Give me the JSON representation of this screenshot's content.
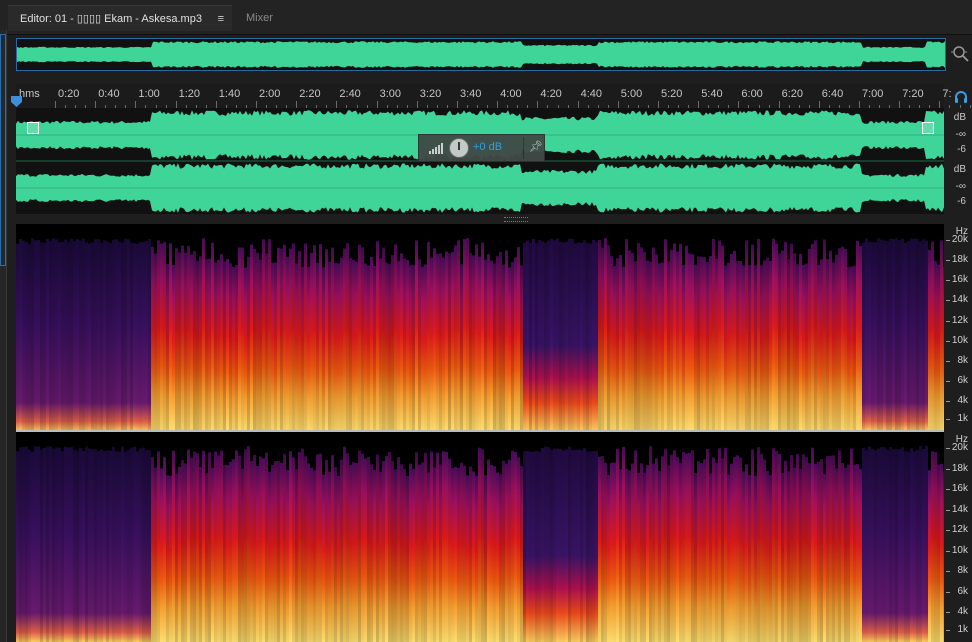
{
  "tabs": {
    "editor_label": "Editor: 01 - ▯▯▯▯ Ekam - Askesa.mp3",
    "editor_menu": "≡",
    "mixer_label": "Mixer"
  },
  "ruler": {
    "unit": "hms",
    "labels": [
      "0:20",
      "0:40",
      "1:00",
      "1:20",
      "1:40",
      "2:00",
      "2:20",
      "2:40",
      "3:00",
      "3:20",
      "3:40",
      "4:00",
      "4:20",
      "4:40",
      "5:00",
      "5:20",
      "5:40",
      "6:00",
      "6:20",
      "6:40",
      "7:00",
      "7:20",
      "7:"
    ]
  },
  "hud": {
    "volume": "+0 dB"
  },
  "amplitude_scale": {
    "left": [
      "dB",
      "-∞",
      "-6"
    ],
    "right": [
      "dB",
      "-∞",
      "-6"
    ]
  },
  "frequency_scale": {
    "unit": "Hz",
    "labels": [
      "20k",
      "18k",
      "16k",
      "14k",
      "12k",
      "10k",
      "8k",
      "6k",
      "4k",
      "1k"
    ]
  },
  "icons": {
    "zoom": "zoom-magnifier-icon",
    "headphones": "headphones-icon",
    "pin": "pin-icon",
    "playhead": "playhead-marker-icon"
  },
  "colors": {
    "waveform": "#3fd498",
    "accent": "#2f9fe3"
  }
}
